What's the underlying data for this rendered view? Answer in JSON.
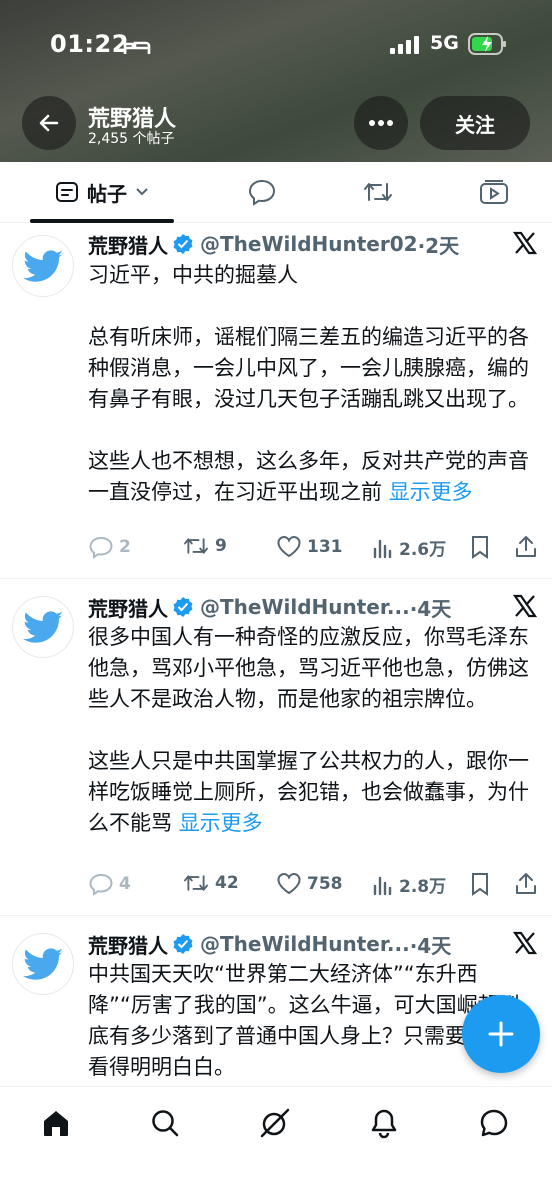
{
  "status_bar": {
    "time": "01:22",
    "network": "5G"
  },
  "header": {
    "name": "荒野猎人",
    "post_count": "2,455 个帖子",
    "follow_label": "关注"
  },
  "tabs": {
    "posts_label": "帖子"
  },
  "colors": {
    "accent": "#1d9bf0",
    "secondary_text": "#536471",
    "verified": "#1d9bf0"
  },
  "tweets": [
    {
      "name": "荒野猎人",
      "handle": "@TheWildHunter02",
      "time": "·2天",
      "paragraphs": [
        "习近平，中共的掘墓人",
        "总有听床师，谣棍们隔三差五的编造习近平的各种假消息，一会儿中风了，一会儿胰腺癌，编的有鼻子有眼，没过几天包子活蹦乱跳又出现了。",
        "这些人也不想想，这么多年，反对共产党的声音一直没停过，在习近平出现之前 "
      ],
      "show_more": "显示更多",
      "replies": "2",
      "retweets": "9",
      "likes": "131",
      "views": "2.6万"
    },
    {
      "name": "荒野猎人",
      "handle": "@TheWildHunter...",
      "time": "·4天",
      "paragraphs": [
        "很多中国人有一种奇怪的应激反应，你骂毛泽东他急，骂邓小平他急，骂习近平他也急，仿佛这些人不是政治人物，而是他家的祖宗牌位。",
        "这些人只是中共国掌握了公共权力的人，跟你一样吃饭睡觉上厕所，会犯错，也会做蠢事，为什么不能骂 "
      ],
      "show_more": "显示更多",
      "replies": "4",
      "retweets": "42",
      "likes": "758",
      "views": "2.8万"
    },
    {
      "name": "荒野猎人",
      "handle": "@TheWildHunter...",
      "time": "·4天",
      "paragraphs": [
        "中共国天天吹“世界第二大经济体”“东升西降”“厉害了我的国”。这么牛逼，可大国崛起到底有多少落到了普通中国人身上？只需要对照就看得明明白白。"
      ]
    }
  ],
  "icons": {
    "back": "arrow-left-icon",
    "more": "more-dots-icon",
    "reply": "reply-icon",
    "retweet": "retweet-icon",
    "like": "heart-icon",
    "views": "views-icon",
    "bookmark": "bookmark-icon",
    "share": "share-icon",
    "fab": "plus-icon",
    "nav": [
      "home-icon",
      "search-icon",
      "grok-icon",
      "notifications-icon",
      "messages-icon"
    ]
  }
}
